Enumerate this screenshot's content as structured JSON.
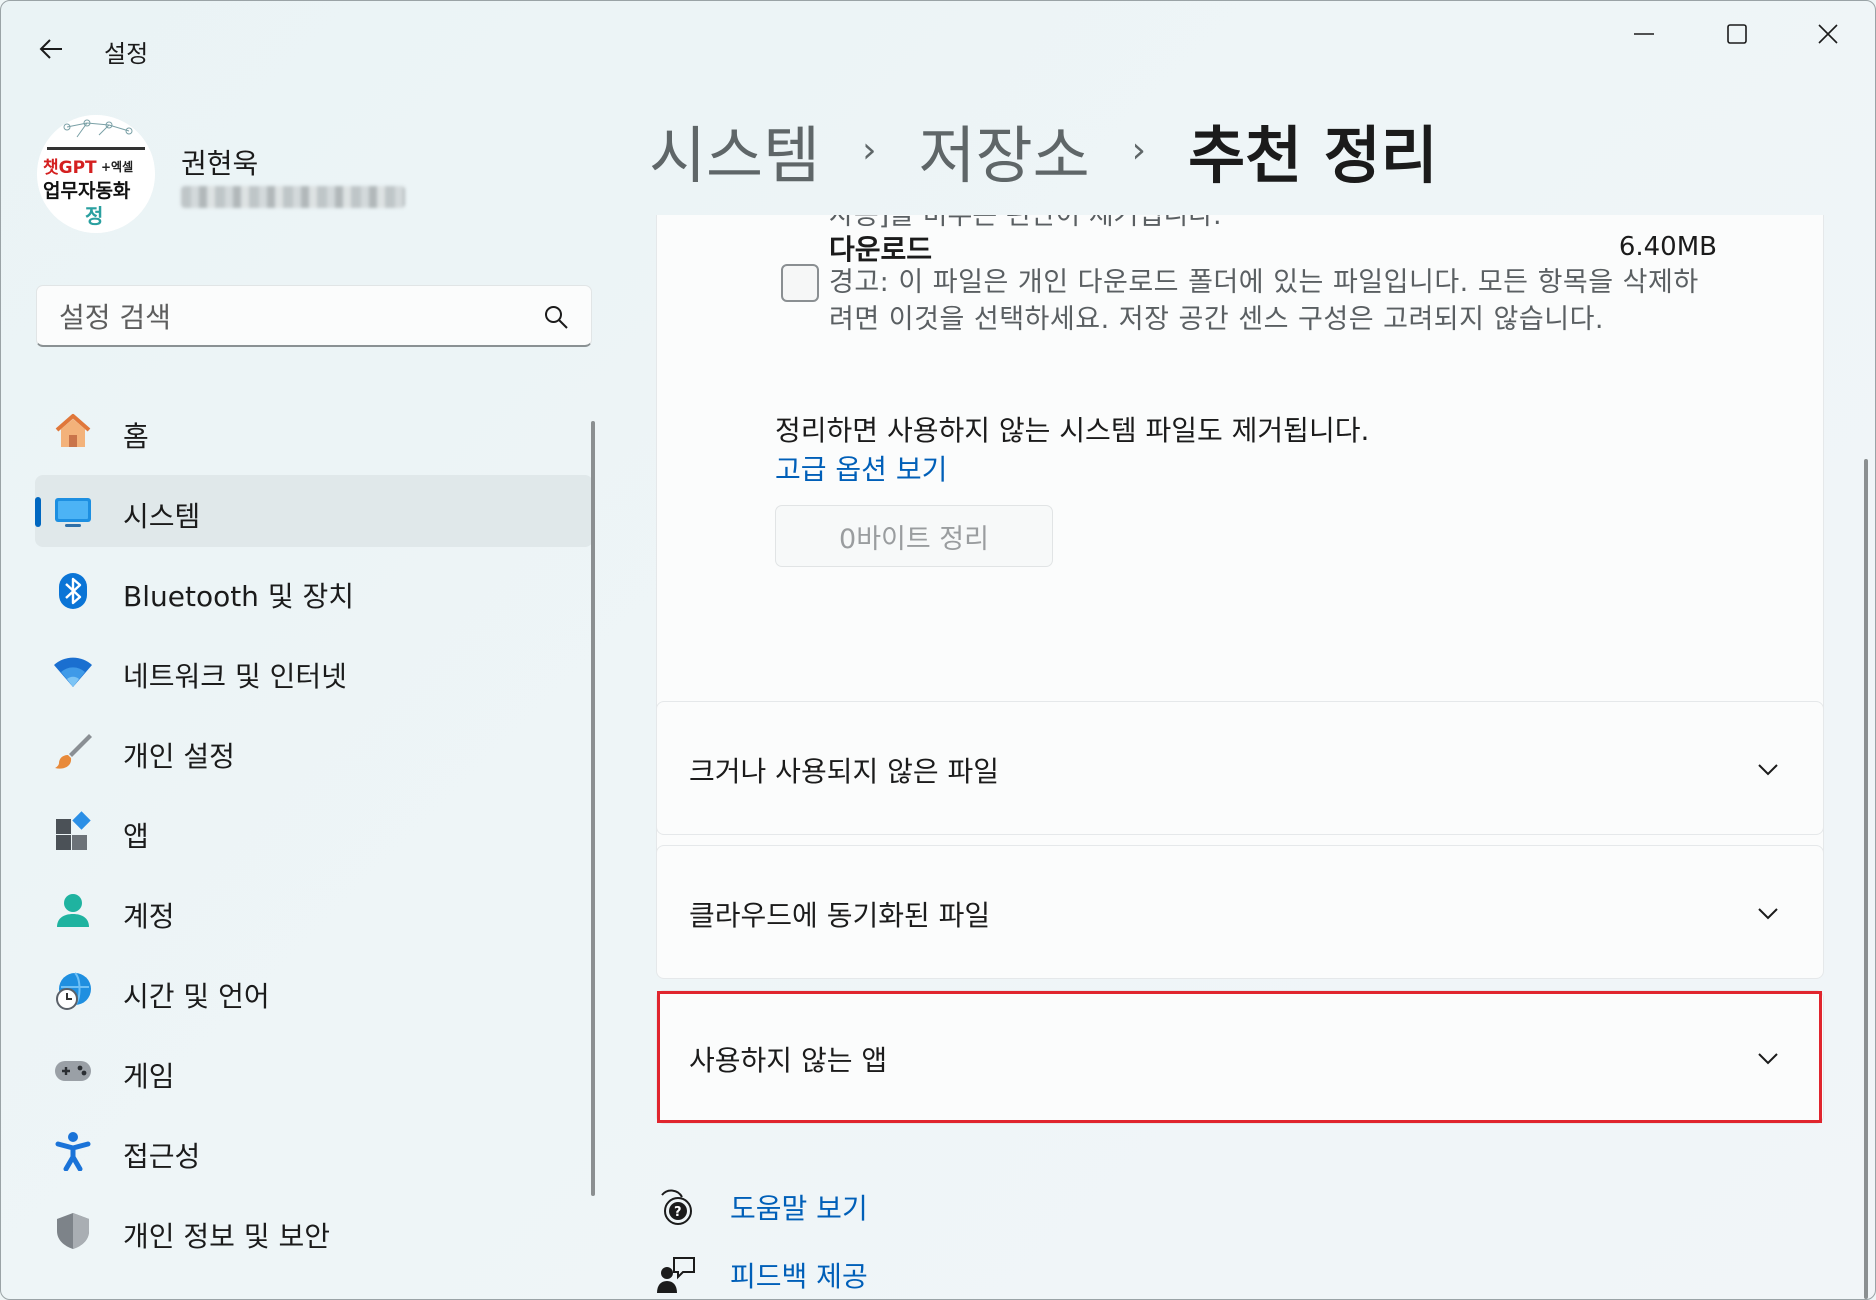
{
  "window": {
    "title": "설정"
  },
  "profile": {
    "name": "권현욱",
    "avatar_text_line1": "챗GPT+엑셀",
    "avatar_text_line2": "업무자동화"
  },
  "search": {
    "placeholder": "설정 검색"
  },
  "nav": {
    "items": [
      {
        "label": "홈",
        "icon": "home-icon"
      },
      {
        "label": "시스템",
        "icon": "system-icon",
        "active": true
      },
      {
        "label": "Bluetooth 및 장치",
        "icon": "bluetooth-icon"
      },
      {
        "label": "네트워크 및 인터넷",
        "icon": "wifi-icon"
      },
      {
        "label": "개인 설정",
        "icon": "brush-icon"
      },
      {
        "label": "앱",
        "icon": "apps-icon"
      },
      {
        "label": "계정",
        "icon": "account-icon"
      },
      {
        "label": "시간 및 언어",
        "icon": "time-language-icon"
      },
      {
        "label": "게임",
        "icon": "gamepad-icon"
      },
      {
        "label": "접근성",
        "icon": "accessibility-icon"
      },
      {
        "label": "개인 정보 및 보안",
        "icon": "shield-icon"
      }
    ]
  },
  "breadcrumb": {
    "item1": "시스템",
    "item2": "저장소",
    "current": "추천 정리",
    "separator": "›"
  },
  "downloads": {
    "cut_text": "사용]을 비우는 편만이 제거됩니다.",
    "title": "다운로드",
    "size": "6.40MB",
    "description": "경고: 이 파일은 개인 다운로드 폴더에 있는 파일입니다. 모든 항목을 삭제하려면 이것을 선택하세요. 저장 공간 센스 구성은 고려되지 않습니다."
  },
  "cleanup": {
    "note": "정리하면 사용하지 않는 시스템 파일도 제거됩니다.",
    "advanced_link": "고급 옵션 보기",
    "button": "0바이트 정리"
  },
  "sections": {
    "large_files": "크거나 사용되지 않은 파일",
    "cloud_files": "클라우드에 동기화된 파일",
    "unused_apps": "사용하지 않는 앱"
  },
  "footer": {
    "help": "도움말 보기",
    "feedback": "피드백 제공"
  },
  "colors": {
    "accent": "#0067c0",
    "link": "#005fb8",
    "highlight": "#e0252e"
  }
}
